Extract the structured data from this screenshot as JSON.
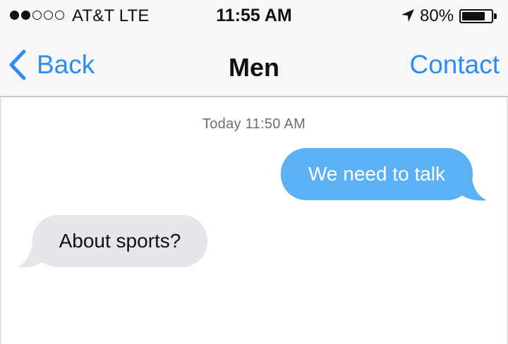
{
  "status_bar": {
    "signal_dots": [
      true,
      true,
      false,
      false,
      false
    ],
    "carrier": "AT&T LTE",
    "time": "11:55 AM",
    "battery_percent": "80%",
    "battery_level": 0.8,
    "icons": {
      "location": "location-arrow-icon",
      "battery": "battery-icon",
      "signal": "signal-dots-icon"
    }
  },
  "nav": {
    "back_label": "Back",
    "title": "Men",
    "contact_label": "Contact",
    "accent_color": "#2f8cf7",
    "icons": {
      "back": "chevron-left-icon"
    }
  },
  "conversation": {
    "timestamp": "Today 11:50 AM",
    "messages": [
      {
        "direction": "sent",
        "text": "We need to talk",
        "color": "#5bb1f3"
      },
      {
        "direction": "received",
        "text": "About sports?",
        "color": "#e5e5ea"
      }
    ]
  }
}
